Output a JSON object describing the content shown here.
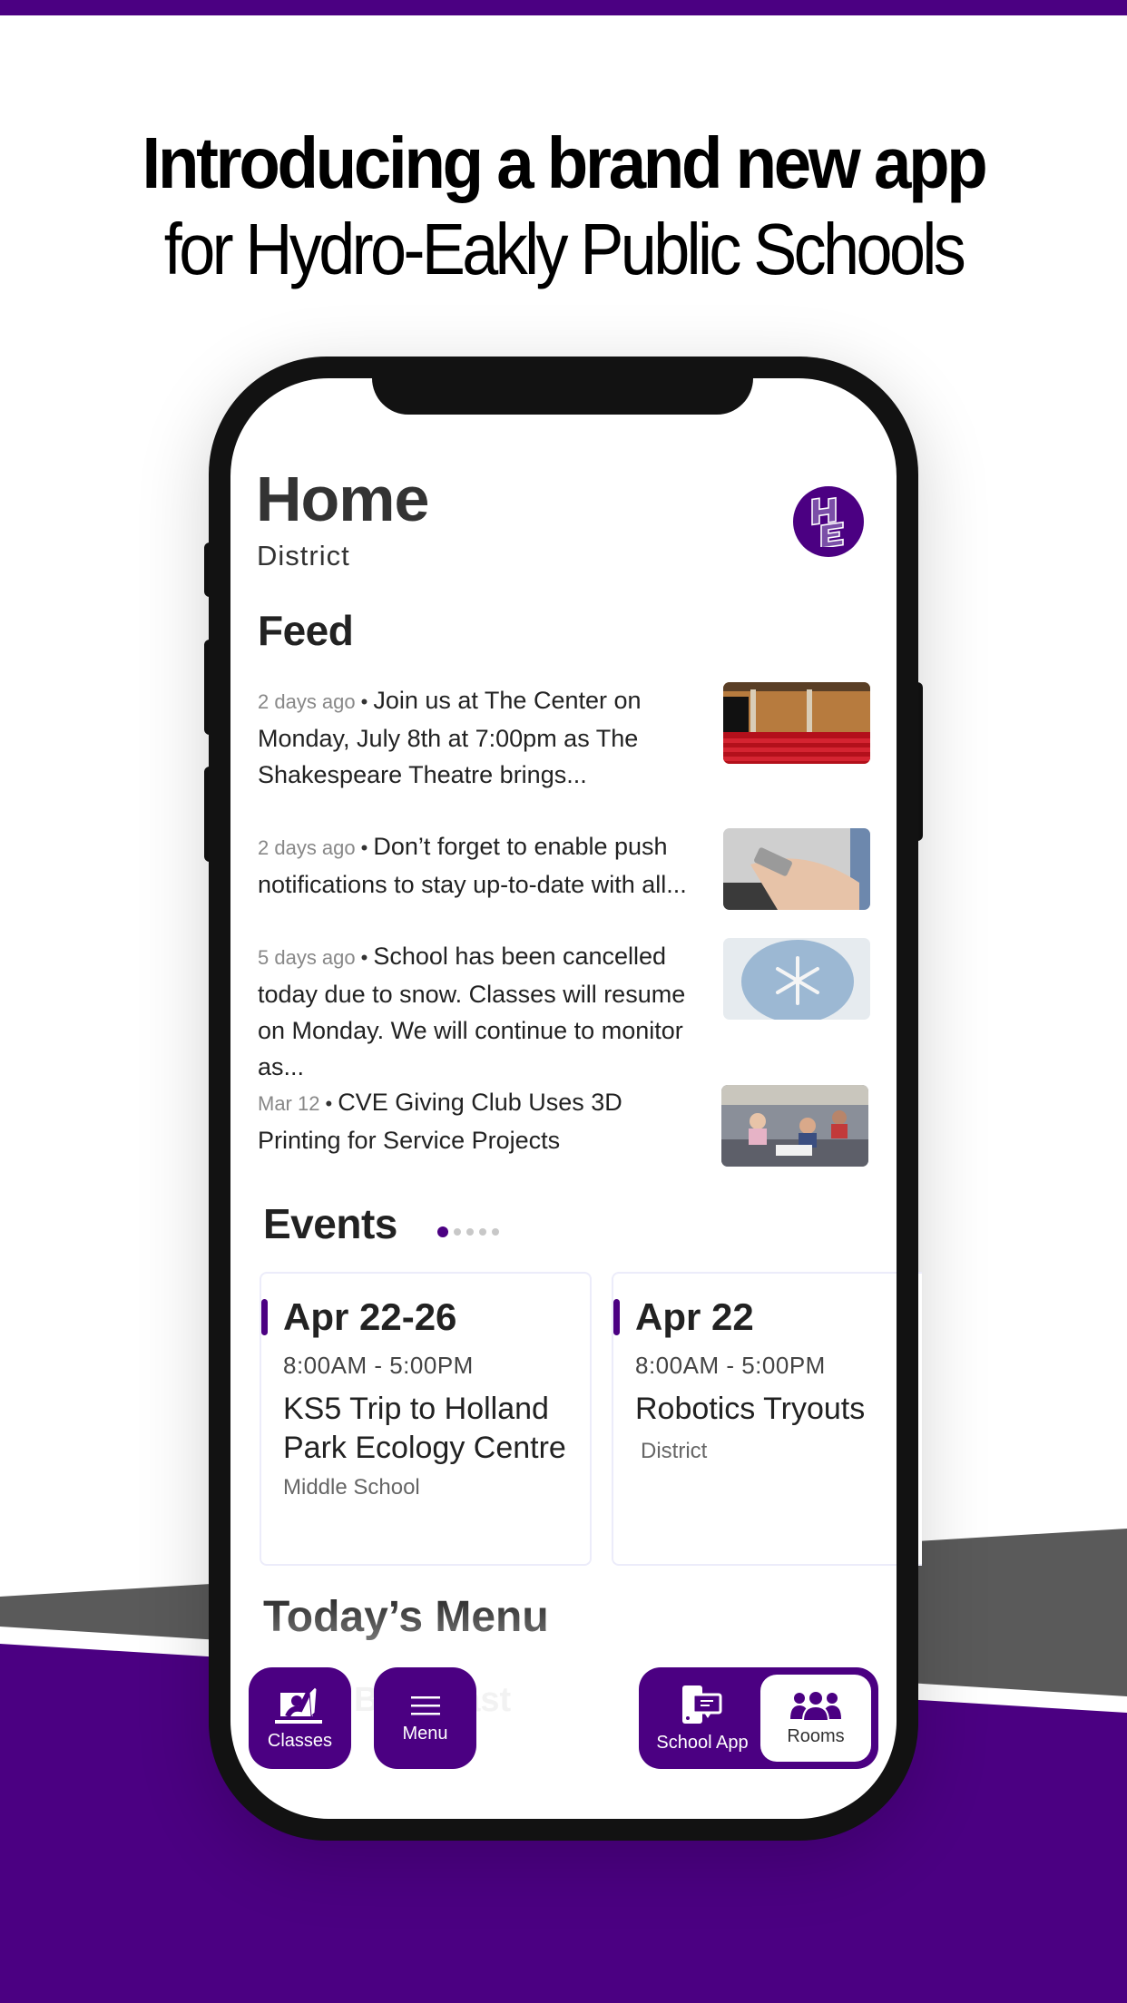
{
  "promo": {
    "headline_line1": "Introducing a brand new app",
    "headline_line2": "for Hydro-Eakly Public Schools"
  },
  "colors": {
    "brand_purple": "#4b0082",
    "band_gray": "#5a5a5a",
    "phone_frame": "#121212"
  },
  "app": {
    "title": "Home",
    "subtitle": "District",
    "logo_text": "HE",
    "feed": {
      "title": "Feed",
      "items": [
        {
          "timestamp": "2 days ago",
          "text": "Join us at The Center on Monday, July 8th at 7:00pm as The Shakespeare Theatre brings...",
          "image": "theatre-seats"
        },
        {
          "timestamp": "2 days ago",
          "text": "Don’t forget to enable push notifications to stay up-to-date with all...",
          "image": "phone-in-hand"
        },
        {
          "timestamp": "5 days ago",
          "text": "School has been cancelled today due to snow. Classes will resume on Monday. We will continue to monitor as...",
          "image": "snowflake-mittens"
        },
        {
          "timestamp": "Mar 12",
          "text": "CVE Giving Club Uses 3D Printing for Service Projects",
          "image": "classroom-kids"
        }
      ]
    },
    "events": {
      "title": "Events",
      "pager": {
        "count": 5,
        "active_index": 0
      },
      "cards": [
        {
          "date": "Apr 22-26",
          "time": "8:00AM  -  5:00PM",
          "name": "KS5 Trip to Holland Park Ecology Centre",
          "location": "Middle School"
        },
        {
          "date": "Apr 22",
          "time": "8:00AM  -  5:00PM",
          "name": "Robotics Tryouts",
          "location": "District"
        }
      ]
    },
    "menu_section": {
      "title": "Today’s Menu",
      "partial_item": "Breakfast"
    },
    "nav": {
      "classes": {
        "label": "Classes",
        "icon": "raised-hand-classroom-icon"
      },
      "menu": {
        "label": "Menu",
        "icon": "hamburger-menu-icon"
      },
      "school_app": {
        "label": "School App",
        "icon": "phone-chat-icon"
      },
      "rooms": {
        "label": "Rooms",
        "icon": "group-people-icon",
        "active": true
      }
    }
  }
}
